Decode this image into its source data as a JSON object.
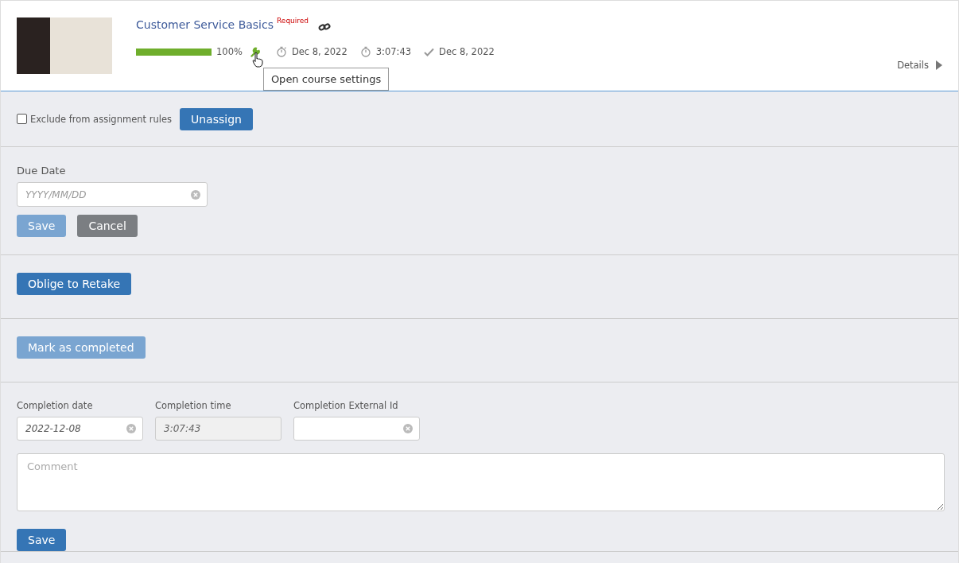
{
  "course": {
    "title": "Customer Service Basics",
    "badge": "Required",
    "progress": {
      "level": 1,
      "reading": "100%"
    },
    "meta": [
      {
        "kind": "started",
        "text": "Dec 8, 2022"
      },
      {
        "kind": "duration",
        "text": "3:07:43"
      },
      {
        "kind": "completed",
        "text": "Dec 8, 2022"
      }
    ],
    "details": "Details",
    "tooltip": "Open course settings"
  },
  "assignment": {
    "exclude": {
      "label": "Exclude from assignment rules",
      "checked": false
    },
    "button": {
      "label": "Unassign",
      "disabled": false
    }
  },
  "due_date": {
    "label": "Due Date",
    "placeholder": "YYYY/MM/DD",
    "buttons": [
      {
        "kind": "primary",
        "label": "Save",
        "disabled": true
      },
      {
        "kind": "secondary",
        "label": "Cancel",
        "disabled": false
      }
    ]
  },
  "retake": {
    "label": "Oblige to Retake",
    "disabled": false
  },
  "mark_completed": {
    "label": "Mark as completed",
    "disabled": true
  },
  "completion": {
    "fields": [
      {
        "label": "Completion date",
        "value": "2022-12-08",
        "disabled": false
      },
      {
        "label": "Completion time",
        "value": "3:07:43",
        "disabled": true
      },
      {
        "label": "Completion External Id",
        "disabled": false
      }
    ],
    "comment_placeholder": "Comment",
    "save": {
      "label": "Save",
      "disabled": false
    }
  }
}
